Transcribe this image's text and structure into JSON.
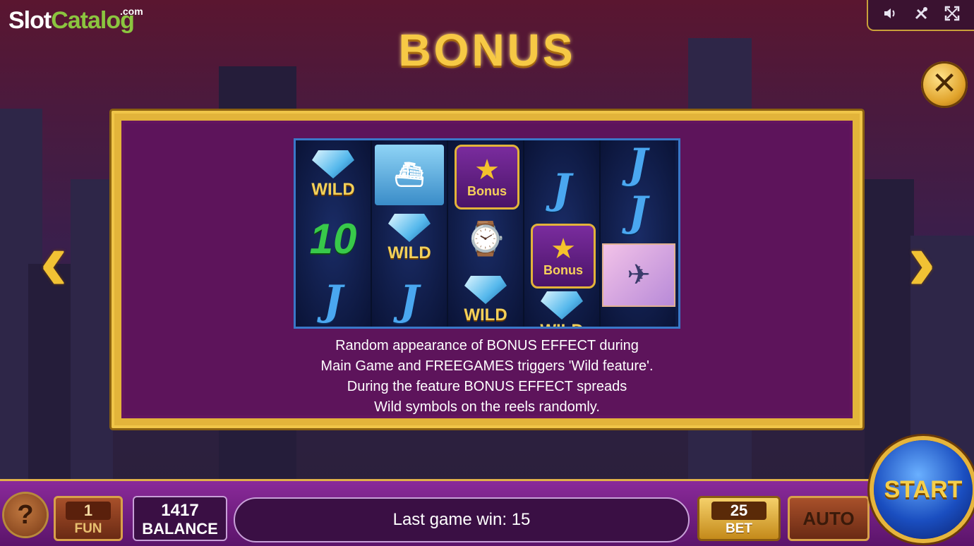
{
  "brand": {
    "slot": "Slot",
    "catalog": "Catalog",
    "com": ".com"
  },
  "toolbar": {
    "sound_icon": "speaker-icon",
    "settings_icon": "tools-icon",
    "fullscreen_icon": "fullscreen-icon"
  },
  "title": "BONUS",
  "close_label": "✕",
  "nav": {
    "prev": "‹",
    "next": "›"
  },
  "reels": [
    [
      "WILD",
      "10",
      "J"
    ],
    [
      "yacht",
      "WILD",
      "J"
    ],
    [
      "Bonus",
      "watch",
      "WILD"
    ],
    [
      "J",
      "Bonus",
      "WILD"
    ],
    [
      "J",
      "J",
      "plane"
    ]
  ],
  "description": [
    "Random appearance of BONUS EFFECT during",
    "Main Game and FREEGAMES triggers 'Wild feature'.",
    "During the feature BONUS EFFECT spreads",
    "Wild symbols on the reels randomly."
  ],
  "bottom": {
    "help": "?",
    "fun_value": "1",
    "fun_label": "FUN",
    "balance_value": "1417",
    "balance_label": "BALANCE",
    "last_win": "Last game win: 15",
    "bet_value": "25",
    "bet_label": "BET",
    "auto_label": "AUTO",
    "start_label": "START"
  },
  "colors": {
    "gold": "#f0c548",
    "panel": "#5d145b",
    "accent_green": "#8bc53f"
  }
}
